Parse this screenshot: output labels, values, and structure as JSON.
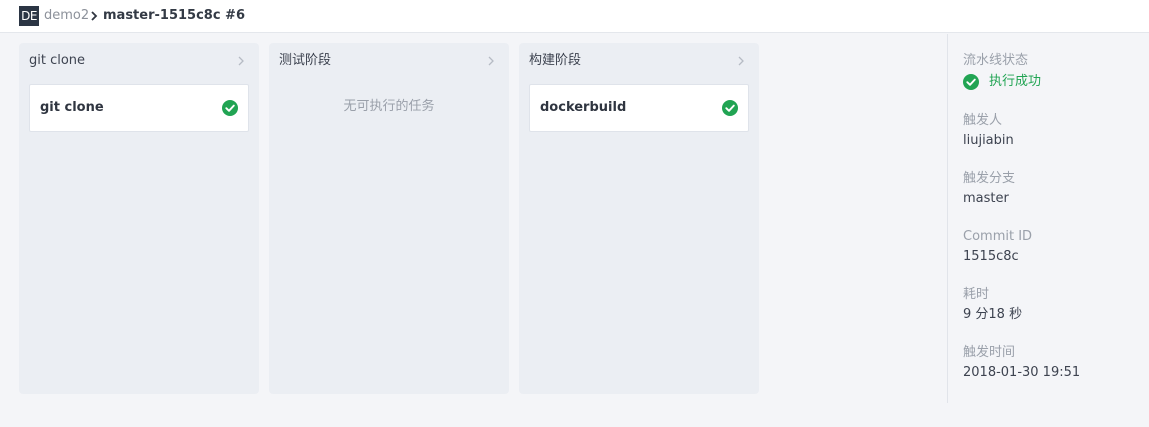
{
  "breadcrumb": {
    "badge": "DE",
    "project": "demo2",
    "build": "master-1515c8c #6"
  },
  "stages": [
    {
      "title": "git clone",
      "tasks": [
        {
          "name": "git clone",
          "status": "success"
        }
      ]
    },
    {
      "title": "测试阶段",
      "tasks": [],
      "empty_text": "无可执行的任务"
    },
    {
      "title": "构建阶段",
      "tasks": [
        {
          "name": "dockerbuild",
          "status": "success"
        }
      ]
    }
  ],
  "info": {
    "pipeline_status": {
      "label": "流水线状态",
      "value": "执行成功"
    },
    "trigger_user": {
      "label": "触发人",
      "value": "liujiabin"
    },
    "trigger_branch": {
      "label": "触发分支",
      "value": "master"
    },
    "commit_id": {
      "label": "Commit ID",
      "value": "1515c8c"
    },
    "duration": {
      "label": "耗时",
      "value": "9 分18 秒"
    },
    "trigger_time": {
      "label": "触发时间",
      "value": "2018-01-30 19:51"
    }
  },
  "colors": {
    "success": "#21a453",
    "stage_bg": "#ebeef3",
    "page_bg": "#f4f5f8"
  },
  "icons": {
    "success": "check-circle-icon",
    "chevron": "chevron-right-icon"
  }
}
